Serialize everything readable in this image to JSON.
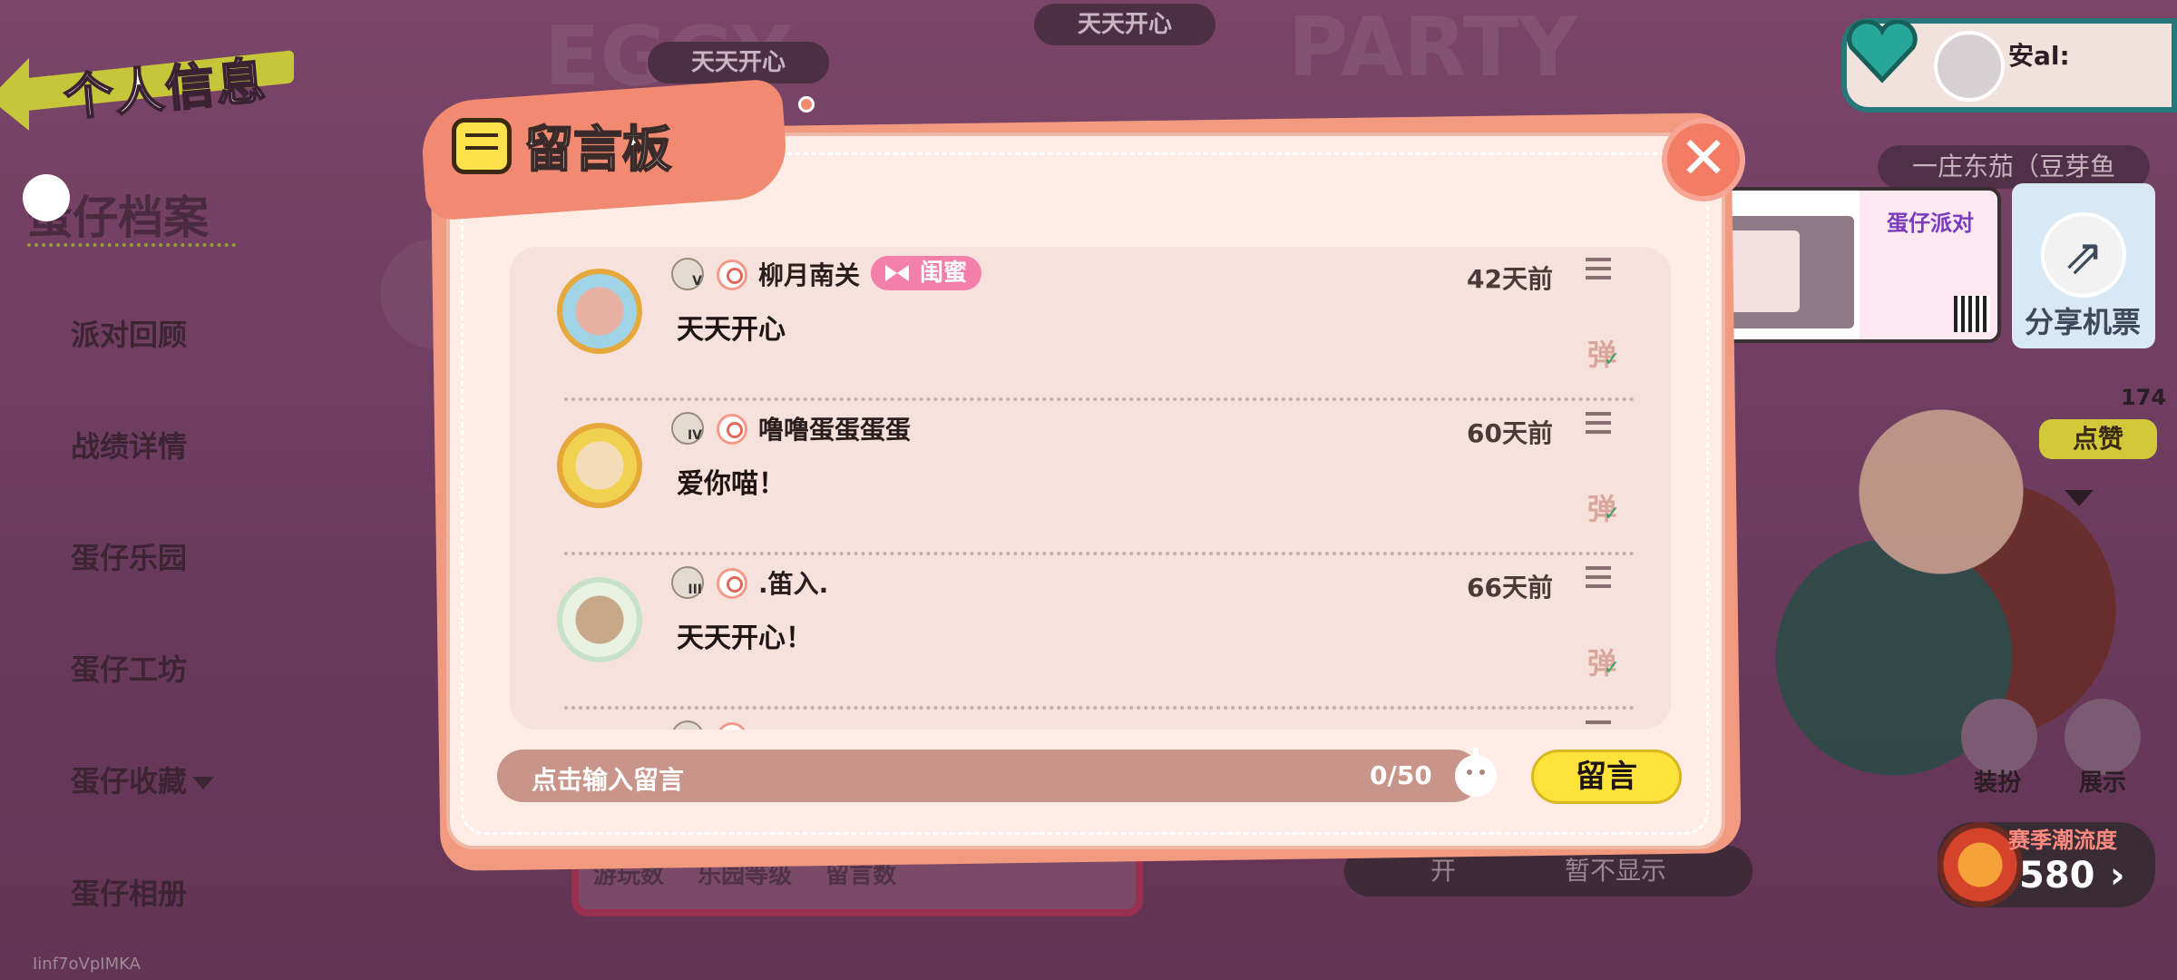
{
  "header": {
    "back_title": "个人信息",
    "top_tab_1": "天天开心",
    "top_tab_2": "天天开心"
  },
  "sidebar": {
    "active": "蛋仔档案",
    "items": [
      {
        "label": "派对回顾"
      },
      {
        "label": "战绩详情"
      },
      {
        "label": "蛋仔乐园"
      },
      {
        "label": "蛋仔工坊"
      },
      {
        "label": "蛋仔收藏"
      },
      {
        "label": "蛋仔相册"
      }
    ],
    "uid": "Iinf7oVpIMKA"
  },
  "profile": {
    "name": "安al:",
    "bean_name": "一庄东茄（豆芽鱼"
  },
  "share": {
    "label": "分享机票",
    "preview_title": "蛋仔派对"
  },
  "like": {
    "count": "174",
    "label": "点赞"
  },
  "actions": {
    "dress_label": "装扮",
    "show_label": "展示"
  },
  "season": {
    "label": "赛季潮流度",
    "value": "580"
  },
  "background_bar": {
    "left_prefix": "开",
    "text": "暂不显示"
  },
  "stats_bar": {
    "items": [
      "游玩数",
      "乐园等级",
      "留言数"
    ]
  },
  "dialog": {
    "title": "留言板",
    "messages": [
      {
        "level": "V",
        "name": "柳月南关",
        "tag": "闺蜜",
        "text": "天天开心",
        "time": "42天前",
        "danmu": "弹"
      },
      {
        "level": "IV",
        "name": "噜噜蛋蛋蛋蛋",
        "tag": "",
        "text": "爱你喵！",
        "time": "60天前",
        "danmu": "弹"
      },
      {
        "level": "III",
        "name": ".笛入.",
        "tag": "",
        "text": "天天开心！",
        "time": "66天前",
        "danmu": "弹"
      },
      {
        "level": "",
        "name": "",
        "tag": "",
        "text": "",
        "time": "",
        "danmu": ""
      }
    ],
    "input": {
      "placeholder": "点击输入留言",
      "counter": "0/50"
    },
    "send_label": "留言"
  },
  "colors": {
    "accent": "#f28a72",
    "send": "#ffe33a",
    "tag": "#f47fa8"
  }
}
